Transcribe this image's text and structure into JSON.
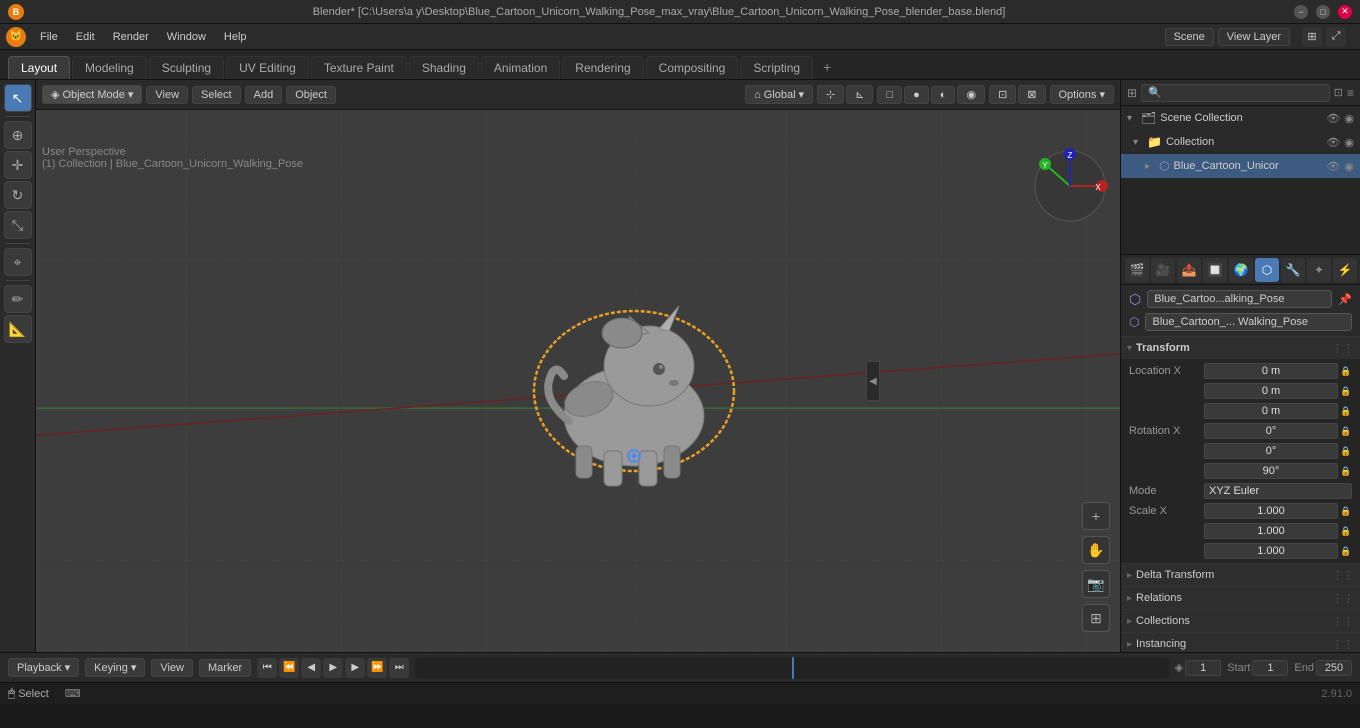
{
  "titlebar": {
    "title": "Blender* [C:\\Users\\a y\\Desktop\\Blue_Cartoon_Unicorn_Walking_Pose_max_vray\\Blue_Cartoon_Unicorn_Walking_Pose_blender_base.blend]",
    "min": "−",
    "max": "□",
    "close": "✕"
  },
  "menubar": {
    "items": [
      "Blender",
      "File",
      "Edit",
      "Render",
      "Window",
      "Help"
    ]
  },
  "workspace_tabs": {
    "tabs": [
      "Layout",
      "Modeling",
      "Sculpting",
      "UV Editing",
      "Texture Paint",
      "Shading",
      "Animation",
      "Rendering",
      "Compositing",
      "Scripting"
    ],
    "active": "Layout",
    "plus": "+"
  },
  "viewport": {
    "header": {
      "mode": "Object Mode",
      "view": "View",
      "select": "Select",
      "add": "Add",
      "object": "Object",
      "transform": "Global",
      "options": "Options ▾"
    },
    "info": {
      "line1": "User Perspective",
      "line2": "(1) Collection | Blue_Cartoon_Unicorn_Walking_Pose"
    },
    "top_right": {
      "scene": "Scene",
      "view_layer": "View Layer"
    }
  },
  "outliner": {
    "header": {
      "search_placeholder": "🔍"
    },
    "scene_collection": "Scene Collection",
    "items": [
      {
        "name": "Collection",
        "indent": 1,
        "expanded": true
      },
      {
        "name": "Blue_Cartoon_Unicor",
        "indent": 2,
        "selected": true
      }
    ]
  },
  "object_header": {
    "name": "Blue_Cartoo...alking_Pose",
    "type_label": "Blue_Cartoon_... Walking_Pose"
  },
  "transform": {
    "title": "Transform",
    "location": {
      "label": "Location",
      "x": "0 m",
      "y": "0 m",
      "z": "0 m"
    },
    "rotation": {
      "label": "Rotation",
      "x": "0°",
      "y": "0°",
      "z": "90°"
    },
    "mode": {
      "label": "Mode",
      "value": "XYZ Euler"
    },
    "scale": {
      "label": "Scale",
      "x": "1.000",
      "y": "1.000",
      "z": "1.000"
    }
  },
  "delta_transform": {
    "title": "▶ Delta Transform"
  },
  "relations": {
    "title": "▶ Relations"
  },
  "collections": {
    "title": "▶ Collections"
  },
  "instancing": {
    "title": "▶ Instancing"
  },
  "bottom_bar": {
    "playback": "Playback",
    "keying": "Keying",
    "view": "View",
    "marker": "Marker",
    "frame_current": "1",
    "start_label": "Start",
    "start_val": "1",
    "end_label": "End",
    "end_val": "250"
  },
  "status_bar": {
    "select": "Select",
    "version": "2.91.0"
  },
  "colors": {
    "accent": "#4a7ab5",
    "active_orange": "#e87d0d",
    "bg_dark": "#1e1e1e",
    "bg_mid": "#2a2a2a",
    "bg_light": "#3a3a3a",
    "selection_outline": "#e8a020"
  }
}
